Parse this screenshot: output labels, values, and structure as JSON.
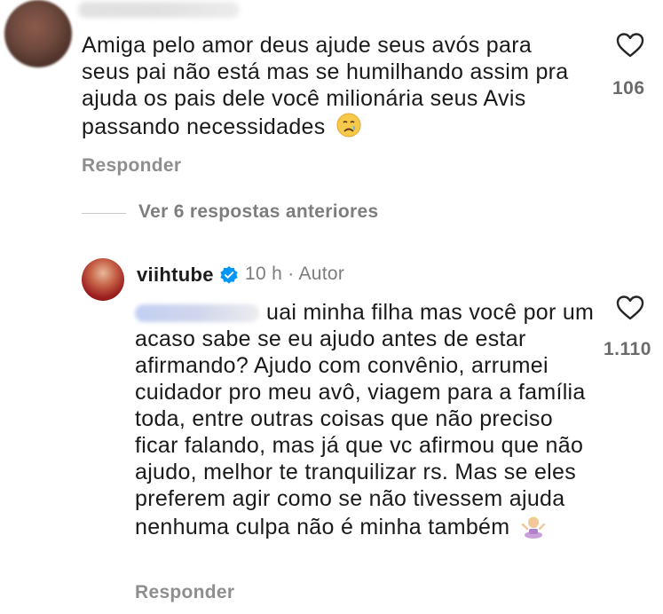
{
  "comment1": {
    "text": "Amiga pelo amor deus ajude seus avós para seus pai não está mas se humilhando assim pra ajuda os pais dele você milionária seus Avis passando necessidades",
    "emoji": "crying-face",
    "likes": "106",
    "reply_label": "Responder"
  },
  "view_replies": "Ver 6 respostas anteriores",
  "comment2": {
    "username": "viihtube",
    "meta": "10 h · Autor",
    "text": "uai minha filha mas você por um acaso sabe se eu ajudo antes de estar afirmando? Ajudo com convênio, arrumei cuidador pro meu avô, viagem para a família toda, entre outras coisas que não preciso ficar falando, mas já que vc afirmou que não ajudo, melhor te tranquilizar rs. Mas se eles preferem agir como se não tivessem ajuda nenhuma culpa não é minha também",
    "emoji": "person-shrugging",
    "likes": "1.110",
    "reply_label": "Responder"
  },
  "colors": {
    "verified": "#0095f6",
    "secondary_text": "#8e8e8e"
  }
}
